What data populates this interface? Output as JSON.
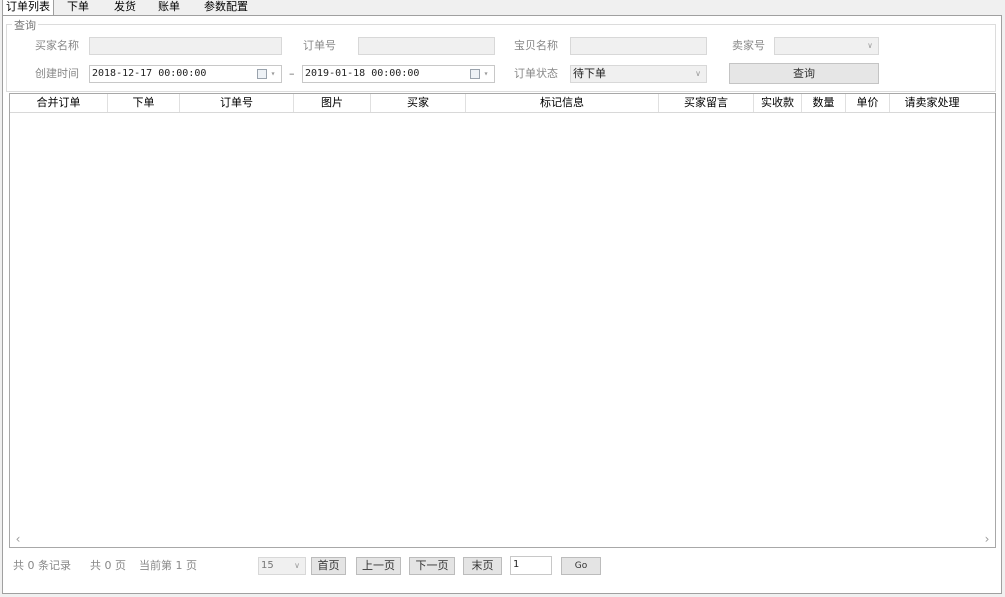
{
  "tabs": [
    "订单列表",
    "下单",
    "发货",
    "账单",
    "参数配置"
  ],
  "query": {
    "group_title": "查询",
    "buyer_name_label": "买家名称",
    "buyer_name_value": "",
    "order_no_label": "订单号",
    "order_no_value": "",
    "item_name_label": "宝贝名称",
    "item_name_value": "",
    "seller_no_label": "卖家号",
    "seller_no_value": "",
    "created_time_label": "创建时间",
    "date_from": "2018-12-17 00:00:00",
    "date_sep": "–",
    "date_to": "2019-01-18 00:00:00",
    "order_status_label": "订单状态",
    "order_status_value": "待下单",
    "search_button": "查询"
  },
  "table": {
    "columns": [
      "合并订单",
      "下单",
      "订单号",
      "图片",
      "买家",
      "标记信息",
      "买家留言",
      "实收款",
      "数量",
      "单价",
      "请卖家处理"
    ],
    "rows": []
  },
  "pager": {
    "total_records": "共 0 条记录",
    "total_pages": "共 0 页",
    "current_page": "当前第 1 页",
    "page_size": "15",
    "first": "首页",
    "prev": "上一页",
    "next": "下一页",
    "last": "末页",
    "goto_value": "1",
    "go": "Go"
  }
}
